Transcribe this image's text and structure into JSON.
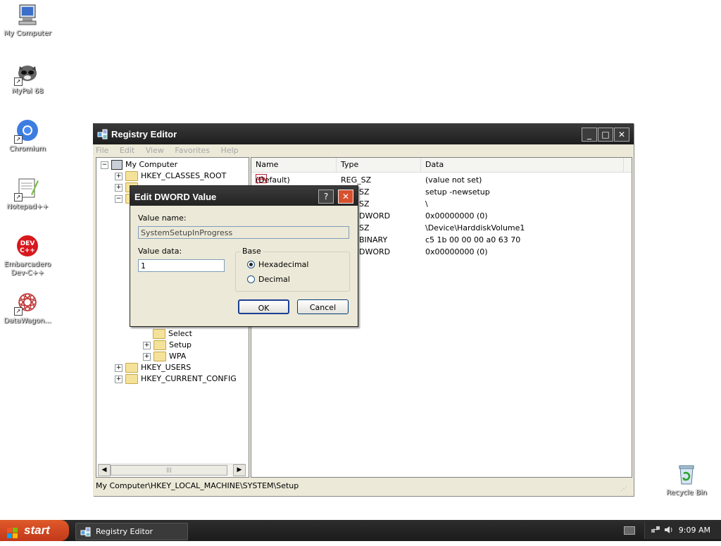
{
  "desktop": {
    "icons": [
      {
        "label": "My Computer",
        "icon": "my-computer-icon"
      },
      {
        "label": "MyPal 68",
        "icon": "mypal-icon"
      },
      {
        "label": "Chromium",
        "icon": "chromium-icon"
      },
      {
        "label": "Notepad++",
        "icon": "notepad-plus-plus-icon"
      },
      {
        "label": "Embarcadero Dev-C++",
        "icon": "devcpp-icon"
      },
      {
        "label": "DataWagon...",
        "icon": "datawagon-icon"
      },
      {
        "label": "Recycle Bin",
        "icon": "recycle-bin-icon"
      }
    ]
  },
  "regedit": {
    "title": "Registry Editor",
    "controls": {
      "minimize": "_",
      "maximize": "□",
      "close": "✕"
    },
    "menu": [
      "File",
      "Edit",
      "View",
      "Favorites",
      "Help"
    ],
    "tree": {
      "root": "My Computer",
      "items": [
        {
          "label": "HKEY_CLASSES_ROOT"
        },
        {
          "label": "Select"
        },
        {
          "label": "Setup"
        },
        {
          "label": "WPA"
        },
        {
          "label": "HKEY_USERS"
        },
        {
          "label": "HKEY_CURRENT_CONFIG"
        }
      ]
    },
    "list": {
      "columns": [
        "Name",
        "Type",
        "Data"
      ],
      "rows": [
        {
          "name": "(Default)",
          "type": "REG_SZ",
          "data": "(value not set)"
        },
        {
          "name": "",
          "type": "SZ",
          "data": "setup -newsetup"
        },
        {
          "name": "",
          "type": "SZ",
          "data": "\\"
        },
        {
          "name": "",
          "type": "DWORD",
          "data": "0x00000000 (0)"
        },
        {
          "name": "",
          "type": "SZ",
          "data": "\\Device\\HarddiskVolume1"
        },
        {
          "name": "",
          "type": "BINARY",
          "data": "c5 1b 00 00 00 a0 63 70"
        },
        {
          "name": "",
          "type": "DWORD",
          "data": "0x00000000 (0)"
        }
      ]
    },
    "status": "My Computer\\HKEY_LOCAL_MACHINE\\SYSTEM\\Setup"
  },
  "dialog": {
    "title": "Edit DWORD Value",
    "help_glyph": "?",
    "close_glyph": "✕",
    "value_name_label": "Value name:",
    "value_name": "SystemSetupInProgress",
    "value_data_label": "Value data:",
    "value_data": "1",
    "base_label": "Base",
    "hex_label": "Hexadecimal",
    "dec_label": "Decimal",
    "selected_base": "Hexadecimal",
    "ok": "OK",
    "cancel": "Cancel"
  },
  "taskbar": {
    "start": "start",
    "task": "Registry Editor",
    "clock": "9:09 AM"
  }
}
